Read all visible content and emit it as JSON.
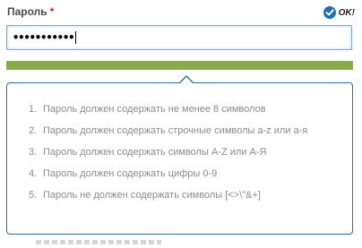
{
  "field": {
    "label": "Пароль",
    "required_mark": "*",
    "status_text": "OK!",
    "value": "•••••••••••"
  },
  "strength": {
    "level": 1.0,
    "color": "#8aab4a"
  },
  "colors": {
    "accent": "#2e6ea6",
    "required": "#d9262a",
    "ok_icon": "#1f6fb8"
  },
  "rules": [
    {
      "num": "1.",
      "text": "Пароль должен содержать не менее 8 символов"
    },
    {
      "num": "2.",
      "text": "Пароль должен содержать строчные символы a-z или а-я"
    },
    {
      "num": "3.",
      "text": "Пароль должен содержать символы A-Z или А-Я"
    },
    {
      "num": "4.",
      "text": "Пароль должен содержать цифры 0-9"
    },
    {
      "num": "5.",
      "text": "Пароль не должен содержать символы [<>\\\"&+]"
    }
  ],
  "icons": {
    "status": "check-circle-icon"
  }
}
